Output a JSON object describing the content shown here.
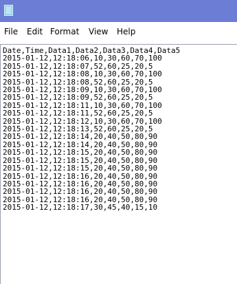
{
  "menu": [
    "File",
    "Edit",
    "Format",
    "View",
    "Help"
  ],
  "editor": {
    "lines": [
      "Date,Time,Data1,Data2,Data3,Data4,Data5",
      "2015-01-12,12:18:06,10,30,60,70,100",
      "2015-01-12,12:18:07,52,60,25,20,5",
      "2015-01-12,12:18:08,10,30,60,70,100",
      "2015-01-12,12:18:08,52,60,25,20,5",
      "2015-01-12,12:18:09,10,30,60,70,100",
      "2015-01-12,12:18:09,52,60,25,20,5",
      "2015-01-12,12:18:11,10,30,60,70,100",
      "2015-01-12,12:18:11,52,60,25,20,5",
      "2015-01-12,12:18:12,10,30,60,70,100",
      "2015-01-12,12:18:13,52,60,25,20,5",
      "2015-01-12,12:18:14,20,40,50,80,90",
      "2015-01-12,12:18:14,20,40,50,80,90",
      "2015-01-12,12:18:15,20,40,50,80,90",
      "2015-01-12,12:18:15,20,40,50,80,90",
      "2015-01-12,12:18:15,20,40,50,80,90",
      "2015-01-12,12:18:16,20,40,50,80,90",
      "2015-01-12,12:18:16,20,40,50,80,90",
      "2015-01-12,12:18:16,20,40,50,80,90",
      "2015-01-12,12:18:16,20,40,50,80,90",
      "2015-01-12,12:18:17,30,45,40,15,10"
    ]
  },
  "colors": {
    "titlebar": "#6b7dd4",
    "editor_border": "#9aa1ad"
  },
  "icons": {
    "app": "notepad-icon"
  }
}
